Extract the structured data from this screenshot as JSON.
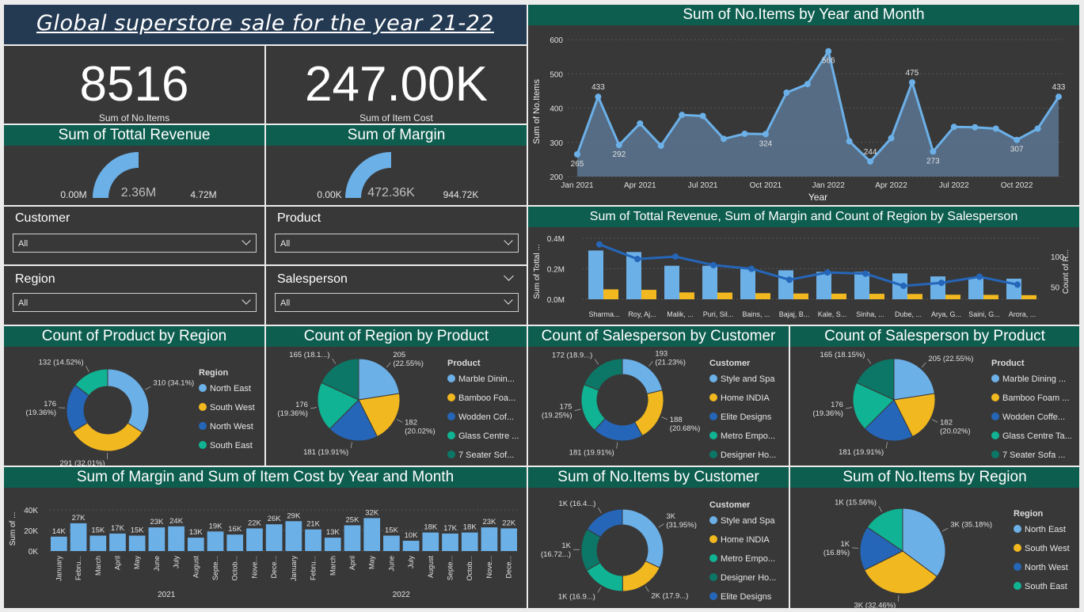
{
  "header": {
    "title": "Global superstore sale for the year 21-22"
  },
  "cards": [
    {
      "value": "8516",
      "label": "Sum of No.Items"
    },
    {
      "value": "247.00K",
      "label": "Sum of Item Cost"
    }
  ],
  "gauges": [
    {
      "title": "Sum of Tottal Revenue",
      "min": "0.00M",
      "value": "2.36M",
      "max": "4.72M",
      "fraction": 0.5
    },
    {
      "title": "Sum of Margin",
      "min": "0.00K",
      "value": "472.36K",
      "max": "944.72K",
      "fraction": 0.5
    }
  ],
  "slicers": [
    {
      "title": "Customer",
      "value": "All"
    },
    {
      "title": "Product",
      "value": "All"
    },
    {
      "title": "Region",
      "value": "All"
    },
    {
      "title": "Salesperson",
      "value": "All"
    }
  ],
  "colors": {
    "blue": "#6cb0e8",
    "yellow": "#f2b81f",
    "darkblue": "#2566b8",
    "teal": "#10b393",
    "darkteal": "#0c7766",
    "header": "#0e5e50",
    "bg": "#383838"
  },
  "chart_data": [
    {
      "id": "items_by_month",
      "type": "area",
      "title": "Sum of No.Items by Year and Month",
      "xlabel": "Year",
      "ylabel": "Sum of No.Items",
      "ylim": [
        200,
        600
      ],
      "yticks": [
        200,
        300,
        400,
        500,
        600
      ],
      "xticks": [
        {
          "i": 0,
          "label": "Jan 2021"
        },
        {
          "i": 3,
          "label": "Apr 2021"
        },
        {
          "i": 6,
          "label": "Jul 2021"
        },
        {
          "i": 9,
          "label": "Oct 2021"
        },
        {
          "i": 12,
          "label": "Jan 2022"
        },
        {
          "i": 15,
          "label": "Apr 2022"
        },
        {
          "i": 18,
          "label": "Jul 2022"
        },
        {
          "i": 21,
          "label": "Oct 2022"
        }
      ],
      "values": [
        265,
        433,
        292,
        355,
        290,
        380,
        377,
        310,
        325,
        324,
        445,
        470,
        566,
        303,
        244,
        312,
        475,
        273,
        345,
        344,
        340,
        307,
        340,
        433
      ],
      "data_labels": [
        {
          "i": 0,
          "text": "265",
          "pos": "below"
        },
        {
          "i": 1,
          "text": "433",
          "pos": "above"
        },
        {
          "i": 2,
          "text": "292",
          "pos": "below"
        },
        {
          "i": 9,
          "text": "324",
          "pos": "below"
        },
        {
          "i": 12,
          "text": "566",
          "pos": "below"
        },
        {
          "i": 14,
          "text": "244",
          "pos": "above"
        },
        {
          "i": 16,
          "text": "475",
          "pos": "above"
        },
        {
          "i": 17,
          "text": "273",
          "pos": "below"
        },
        {
          "i": 21,
          "text": "307",
          "pos": "below"
        },
        {
          "i": 23,
          "text": "433",
          "pos": "above"
        }
      ]
    },
    {
      "id": "salesperson_combo",
      "type": "bar",
      "title": "Sum of Tottal Revenue, Sum of Margin and Count of Region by Salesperson",
      "ylabel": "Sum of Tottal ...",
      "y2label": "Count of R...",
      "ylim": [
        0,
        0.4
      ],
      "yticks": [
        {
          "v": 0,
          "label": "0.0M"
        },
        {
          "v": 0.2,
          "label": "0.2M"
        },
        {
          "v": 0.4,
          "label": "0.4M"
        }
      ],
      "y2lim": [
        30,
        130
      ],
      "y2ticks": [
        50,
        100
      ],
      "categories": [
        "Sharma...",
        "Roy, Aj...",
        "Malik, ...",
        "Puri, Sil...",
        "Bains, ...",
        "Bajaj, B...",
        "Kale, S...",
        "Sinha, ...",
        "Dube, ...",
        "Arya, G...",
        "Saini, G...",
        "Arora, ..."
      ],
      "series": [
        {
          "name": "Sum of Tottal Revenue",
          "values": [
            0.32,
            0.31,
            0.22,
            0.22,
            0.2,
            0.19,
            0.18,
            0.18,
            0.17,
            0.15,
            0.145,
            0.135
          ]
        },
        {
          "name": "Sum of Margin",
          "values": [
            0.065,
            0.062,
            0.045,
            0.044,
            0.04,
            0.038,
            0.037,
            0.036,
            0.035,
            0.03,
            0.029,
            0.027
          ]
        },
        {
          "name": "Count of Region",
          "values": [
            120,
            96,
            100,
            86,
            80,
            62,
            74,
            72,
            52,
            57,
            67,
            54
          ]
        }
      ]
    },
    {
      "id": "product_by_region",
      "type": "pie",
      "donut": true,
      "title": "Count of Product by Region",
      "legend_title": "Region",
      "labels": [
        "North East",
        "South West",
        "North West",
        "South East"
      ],
      "values": [
        310,
        291,
        176,
        132
      ],
      "slice_labels": [
        "310 (34.1%)",
        "291 (32.01%)",
        "176\n(19.36%)",
        "132 (14.52%)"
      ],
      "colors": [
        "#6cb0e8",
        "#f2b81f",
        "#2566b8",
        "#10b393"
      ]
    },
    {
      "id": "region_by_product",
      "type": "pie",
      "title": "Count of Region by Product",
      "legend_title": "Product",
      "labels": [
        "Marble Dinin...",
        "Bamboo Foa...",
        "Wodden Cof...",
        "Glass Centre ...",
        "7 Seater Sof..."
      ],
      "values": [
        205,
        182,
        181,
        176,
        165
      ],
      "slice_labels": [
        "205\n(22.55%)",
        "182\n(20.02%)",
        "181 (19.91%)",
        "176\n(19.36%)",
        "165 (18.1...)"
      ],
      "colors": [
        "#6cb0e8",
        "#f2b81f",
        "#2566b8",
        "#10b393",
        "#0c7766"
      ]
    },
    {
      "id": "salesperson_by_customer",
      "type": "pie",
      "donut": true,
      "title": "Count of Salesperson by Customer",
      "legend_title": "Customer",
      "labels": [
        "Style and Spa",
        "Home INDIA",
        "Elite Designs",
        "Metro Empo...",
        "Designer Ho..."
      ],
      "values": [
        193,
        188,
        181,
        175,
        172
      ],
      "slice_labels": [
        "193\n(21.23%)",
        "188\n(20.68%)",
        "181 (19.91%)",
        "175\n(19.25%)",
        "172 (18.9...)"
      ],
      "colors": [
        "#6cb0e8",
        "#f2b81f",
        "#2566b8",
        "#10b393",
        "#0c7766"
      ]
    },
    {
      "id": "salesperson_by_product",
      "type": "pie",
      "title": "Count of Salesperson by Product",
      "legend_title": "Product",
      "labels": [
        "Marble Dining ...",
        "Bamboo Foam ...",
        "Wodden Coffe...",
        "Glass Centre Ta...",
        "7 Seater Sofa ..."
      ],
      "values": [
        205,
        182,
        181,
        176,
        165
      ],
      "slice_labels": [
        "205 (22.55%)",
        "182\n(20.02%)",
        "181 (19.91%)",
        "176\n(19.36%)",
        "165 (18.15%)"
      ],
      "colors": [
        "#6cb0e8",
        "#f2b81f",
        "#2566b8",
        "#10b393",
        "#0c7766"
      ]
    },
    {
      "id": "margin_itemcost_by_month",
      "type": "bar",
      "title": "Sum of Margin and Sum of Item Cost by Year and Month",
      "ylabel": "Sum of ...",
      "ylim": [
        0,
        40
      ],
      "yticks": [
        {
          "v": 0,
          "label": "0K"
        },
        {
          "v": 20,
          "label": "20K"
        },
        {
          "v": 40,
          "label": "40K"
        }
      ],
      "categories": [
        "January",
        "Febru...",
        "March",
        "April",
        "May",
        "June",
        "July",
        "August",
        "Septe...",
        "Octob...",
        "Nove...",
        "Dece...",
        "January",
        "Febru...",
        "March",
        "April",
        "May",
        "June",
        "July",
        "August",
        "Septe...",
        "Octob...",
        "Nove...",
        "Dece..."
      ],
      "years": [
        {
          "label": "2021",
          "from": 0,
          "to": 11
        },
        {
          "label": "2022",
          "from": 12,
          "to": 23
        }
      ],
      "values": [
        14,
        27,
        15,
        17,
        15,
        23,
        24,
        13,
        19,
        16,
        22,
        26,
        29,
        21,
        13,
        25,
        32,
        15,
        10,
        18,
        17,
        18,
        23,
        22
      ],
      "value_labels": [
        "14K",
        "27K",
        "15K",
        "17K",
        "15K",
        "23K",
        "24K",
        "13K",
        "19K",
        "16K",
        "22K",
        "26K",
        "29K",
        "21K",
        "13K",
        "25K",
        "32K",
        "15K",
        "10K",
        "18K",
        "17K",
        "18K",
        "23K",
        "22K"
      ]
    },
    {
      "id": "items_by_customer",
      "type": "pie",
      "donut": true,
      "title": "Sum of No.Items by Customer",
      "legend_title": "Customer",
      "labels": [
        "Style and Spa",
        "Home INDIA",
        "Metro Empo...",
        "Designer Ho...",
        "Elite Designs"
      ],
      "values": [
        31.95,
        17.9,
        16.9,
        16.72,
        16.4
      ],
      "slice_labels": [
        "3K\n(31.95%)",
        "2K (17.9...)",
        "1K (16.9...)",
        "1K\n(16.72...)",
        "1K (16.4...)"
      ],
      "colors": [
        "#6cb0e8",
        "#f2b81f",
        "#10b393",
        "#0c7766",
        "#2566b8"
      ]
    },
    {
      "id": "items_by_region",
      "type": "pie",
      "title": "Sum of No.Items by Region",
      "legend_title": "Region",
      "labels": [
        "North East",
        "South West",
        "North West",
        "South East"
      ],
      "values": [
        35.18,
        32.46,
        16.8,
        15.56
      ],
      "slice_labels": [
        "3K (35.18%)",
        "3K (32.46%)",
        "1K\n(16.8%)",
        "1K (15.56%)"
      ],
      "colors": [
        "#6cb0e8",
        "#f2b81f",
        "#2566b8",
        "#10b393"
      ]
    }
  ]
}
